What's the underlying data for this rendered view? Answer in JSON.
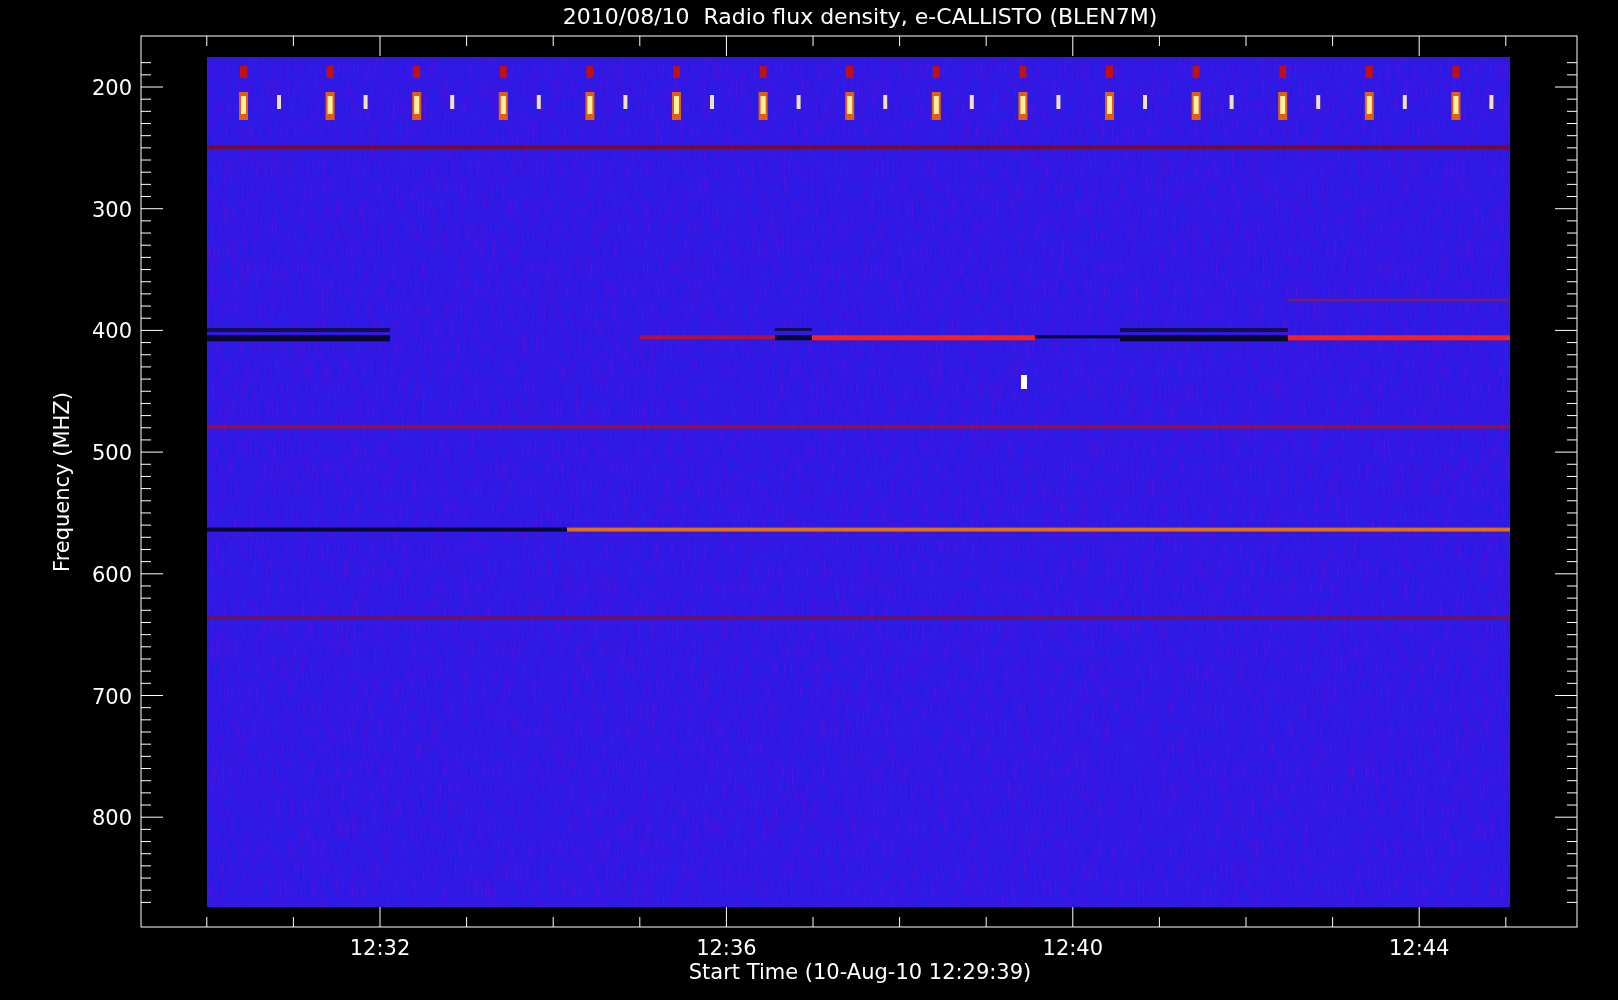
{
  "title": "2010/08/10  Radio flux density, e-CALLISTO (BLEN7M)",
  "y_axis": {
    "label": "Frequency (MHZ)",
    "ticks": [
      "200",
      "300",
      "400",
      "500",
      "600",
      "700",
      "800"
    ]
  },
  "x_axis": {
    "label": "Start Time (10-Aug-10 12:29:39)",
    "ticks": [
      "12:32",
      "12:36",
      "12:40",
      "12:44"
    ]
  }
}
